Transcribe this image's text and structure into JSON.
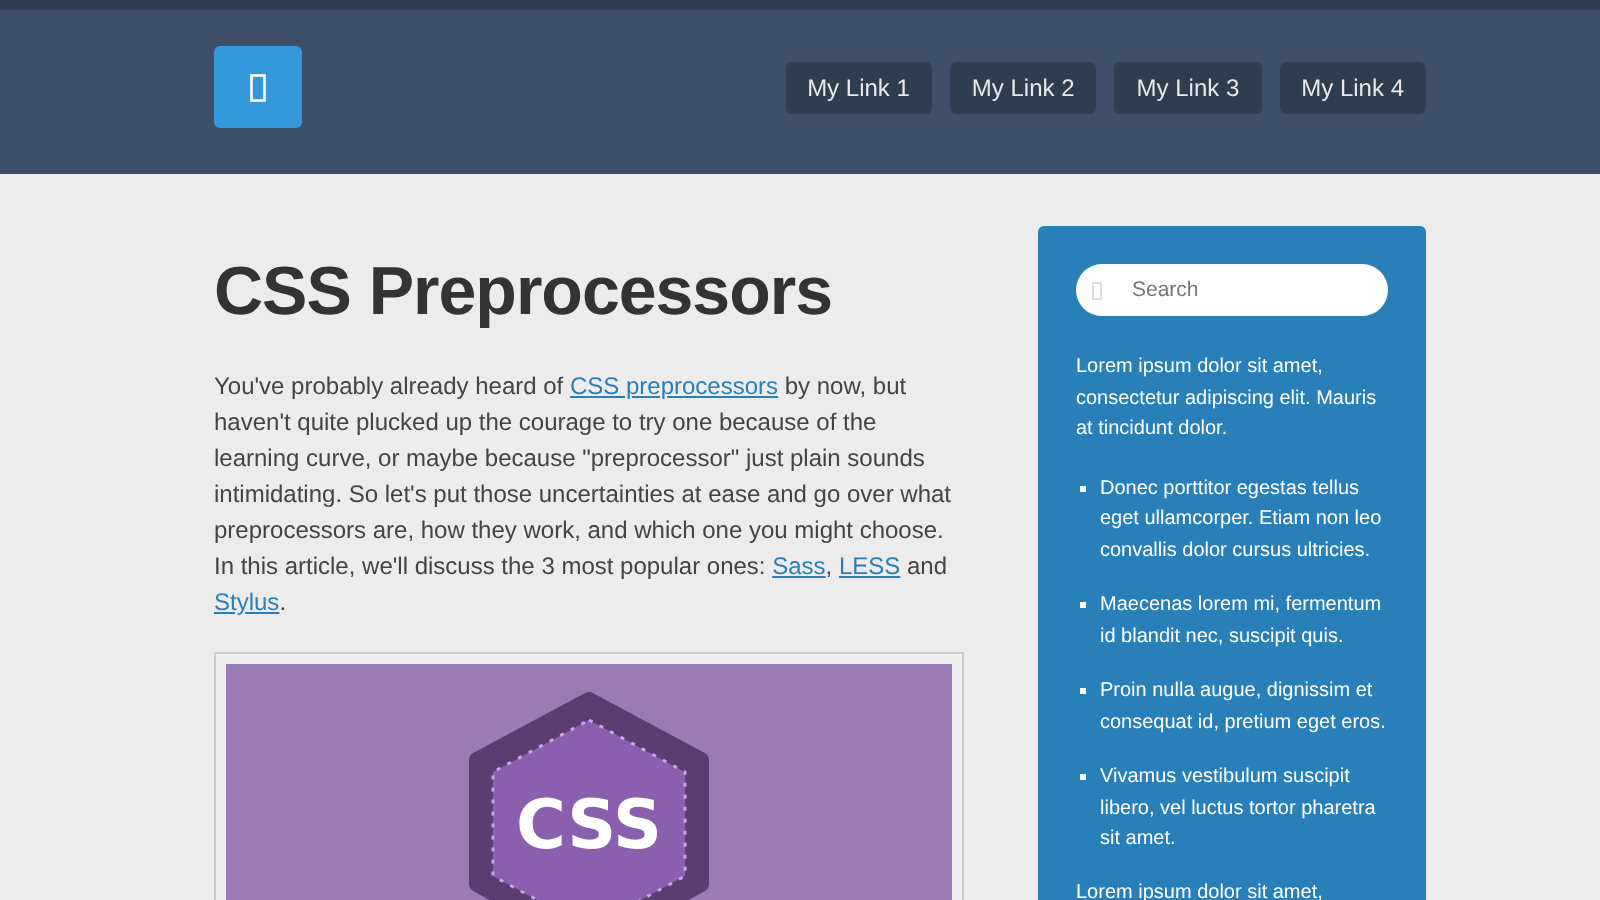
{
  "header": {
    "nav_links": [
      {
        "label": "My Link 1"
      },
      {
        "label": "My Link 2"
      },
      {
        "label": "My Link 3"
      },
      {
        "label": "My Link 4"
      }
    ]
  },
  "article": {
    "title": "CSS Preprocessors",
    "intro": [
      {
        "kind": "text",
        "text": "You've probably already heard of "
      },
      {
        "kind": "link",
        "text": "CSS preprocessors"
      },
      {
        "kind": "text",
        "text": " by now, but haven't quite plucked up the courage to try one because of the learning curve, or maybe because \"preprocessor\" just plain sounds intimidating. So let's put those uncertainties at ease and go over what preprocessors are, how they work, and which one you might choose. In this article, we'll discuss the 3 most popular ones: "
      },
      {
        "kind": "link",
        "text": "Sass"
      },
      {
        "kind": "text",
        "text": ", "
      },
      {
        "kind": "link",
        "text": "LESS"
      },
      {
        "kind": "text",
        "text": " and "
      },
      {
        "kind": "link",
        "text": "Stylus"
      },
      {
        "kind": "text",
        "text": "."
      }
    ],
    "image": {
      "badge_text": "CSS"
    }
  },
  "sidebar": {
    "search": {
      "placeholder": "Search"
    },
    "intro": "Lorem ipsum dolor sit amet, consectetur adipiscing elit. Mauris at tincidunt dolor.",
    "list": [
      "Donec porttitor egestas tellus eget ullamcorper. Etiam non leo convallis dolor cursus ultricies.",
      "Maecenas lorem mi, fermentum id blandit nec, suscipit quis.",
      "Proin nulla augue, dignissim et consequat id, pretium eget eros.",
      "Vivamus vestibulum suscipit libero, vel luctus tortor pharetra sit amet."
    ],
    "outro": "Lorem ipsum dolor sit amet,"
  }
}
